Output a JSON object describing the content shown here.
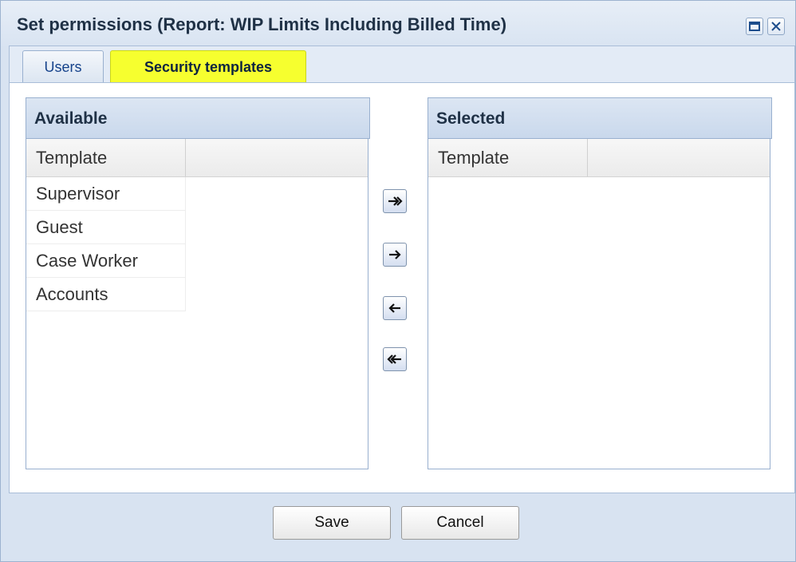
{
  "window": {
    "title": "Set permissions (Report: WIP Limits Including Billed Time)"
  },
  "tabs": [
    {
      "label": "Users",
      "active": false
    },
    {
      "label": "Security templates",
      "active": true
    }
  ],
  "available": {
    "header": "Available",
    "column": "Template",
    "rows": [
      "Supervisor",
      "Guest",
      "Case Worker",
      "Accounts"
    ]
  },
  "selected": {
    "header": "Selected",
    "column": "Template",
    "rows": []
  },
  "move_buttons": [
    {
      "icon": "move-all-right-icon"
    },
    {
      "icon": "move-right-icon"
    },
    {
      "icon": "move-left-icon"
    },
    {
      "icon": "move-all-left-icon"
    }
  ],
  "buttons": {
    "save": "Save",
    "cancel": "Cancel"
  },
  "colors": {
    "active_tab_highlight": "#f6ff2f",
    "window_frame": "#d8e3f1"
  }
}
